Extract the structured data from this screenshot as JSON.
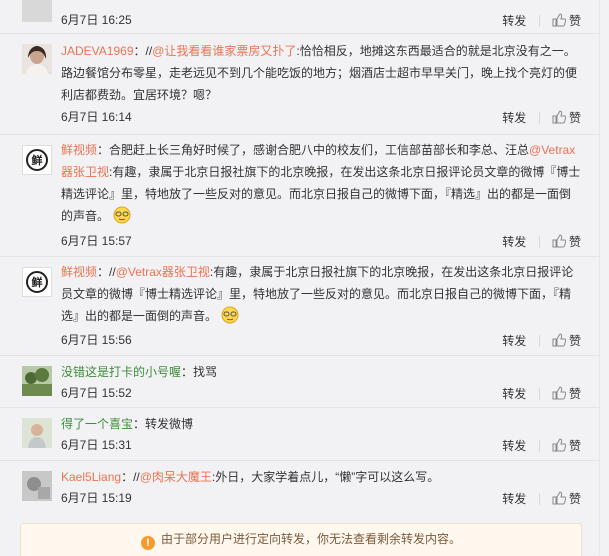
{
  "actions": {
    "repost": "转发",
    "like": "赞"
  },
  "comments": [
    {
      "user": "",
      "text": "",
      "time": "6月7日 16:25"
    },
    {
      "user": "JADEVA1969",
      "colon": "：//",
      "at": "@让我看看谁家票房又扑了",
      "text": ":恰恰相反，地摊这东西最适合的就是北京没有之一。路边餐馆分布零星，走老远见不到几个能吃饭的地方；烟酒店士超市早早关门，晚上找个亮灯的便利店都费劲。宜居环境？嗯？",
      "time": "6月7日 16:14"
    },
    {
      "user": "鲜视频",
      "text": "：合肥赶上长三角好时候了，感谢合肥八中的校友们，工信部苗部长和李总、汪总",
      "at": "@Vetrax器张卫视",
      "text2": ":有趣，隶属于北京日报社旗下的北京晚报，在发出这条北京日报评论员文章的微博『博士精选评论』里，特地放了一些反对的意见。而北京日报自己的微博下面，『精选』出的都是一面倒的声音。",
      "time": "6月7日 15:57"
    },
    {
      "user": "鲜视频",
      "colon": "：//",
      "at": "@Vetrax器张卫视",
      "text": ":有趣，隶属于北京日报社旗下的北京晚报，在发出这条北京日报评论员文章的微博『博士精选评论』里，特地放了一些反对的意见。而北京日报自己的微博下面，『精选』出的都是一面倒的声音。",
      "time": "6月7日 15:56"
    },
    {
      "user": "没错这是打卡的小号喔",
      "text": "：找骂",
      "time": "6月7日 15:52"
    },
    {
      "user": "得了一个喜宝",
      "text": "：转发微博",
      "time": "6月7日 15:31"
    },
    {
      "user": "Kael5Liang",
      "colon": "：//",
      "at": "@肉呆大魔王",
      "text": ":外日，大家学着点儿，“懒”字可以这么写。",
      "time": "6月7日 15:19"
    }
  ],
  "notice": "由于部分用户进行定向转发，你无法查看剩余转发内容。",
  "colors": {
    "username": "#eb7350",
    "username_green": "#3f8c3a",
    "notice_bg": "#fff8ef"
  },
  "icons": {
    "like": "thumbs-up-icon",
    "notice": "warning-icon",
    "emoji": "sunglasses-emoji-icon"
  }
}
